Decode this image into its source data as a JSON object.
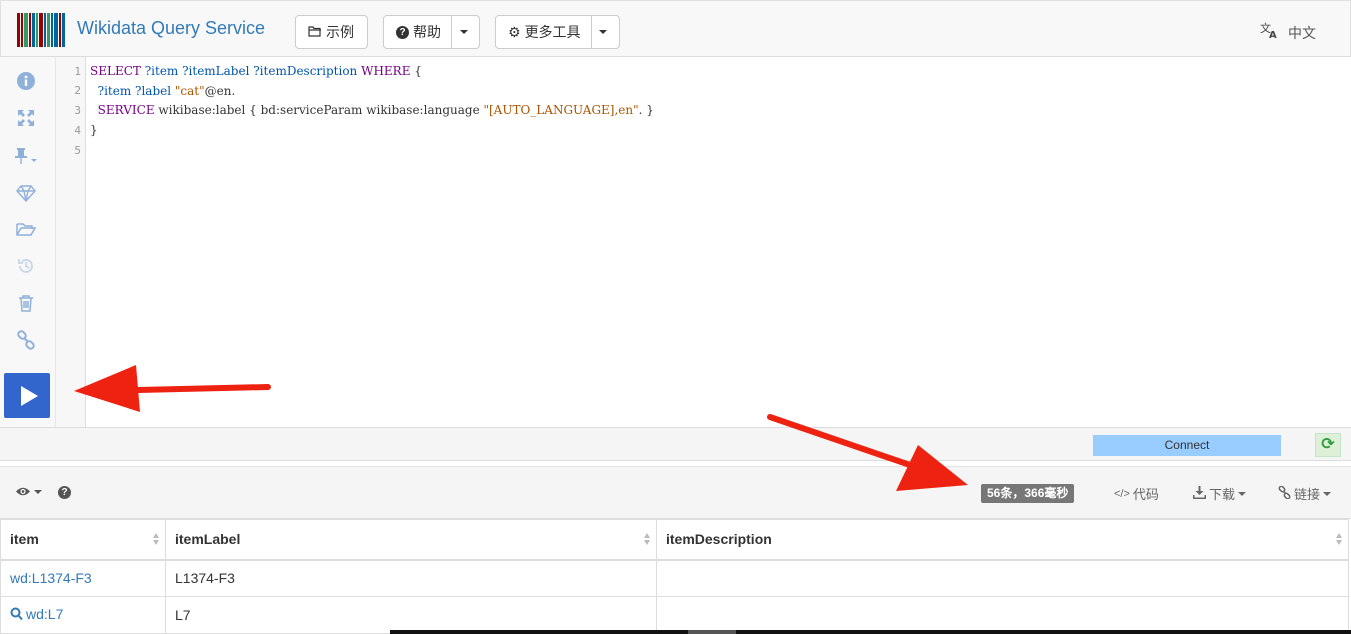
{
  "navbar": {
    "title": "Wikidata Query Service",
    "examples_label": "示例",
    "help_label": "帮助",
    "more_tools_label": "更多工具",
    "language_label": "中文"
  },
  "toolbar": {
    "icons": [
      "info-icon",
      "expand-icon",
      "pin-icon",
      "gem-icon",
      "folder-open-icon",
      "history-icon",
      "trash-icon",
      "link-icon"
    ],
    "run_label": "run"
  },
  "editor": {
    "line_numbers": [
      "1",
      "2",
      "3",
      "4",
      "5"
    ],
    "lines": {
      "l1_kw1": "SELECT",
      "l1_vars": " ?item ?itemLabel ?itemDescription ",
      "l1_kw2": "WHERE",
      "l1_brace": " {",
      "l2_indent": "  ",
      "l2_vars": "?item ?label ",
      "l2_str": "\"cat\"",
      "l2_rest": "@en.",
      "l3_indent": "  ",
      "l3_kw": "SERVICE",
      "l3_mid": " wikibase:label { bd:serviceParam wikibase:language ",
      "l3_str": "\"[AUTO_LANGUAGE],en\"",
      "l3_end": ". }",
      "l4": "}"
    }
  },
  "statusbar": {
    "connect_label": "Connect"
  },
  "results": {
    "count_badge": "56条，366毫秒",
    "code_label": "代码",
    "download_label": "下载",
    "link_label": "链接",
    "columns": [
      "item",
      "itemLabel",
      "itemDescription"
    ],
    "rows": [
      {
        "item": "wd:L1374-F3",
        "itemLabel": "L1374-F3",
        "itemDescription": ""
      },
      {
        "item": "wd:L7",
        "itemLabel": "L7",
        "itemDescription": ""
      }
    ]
  },
  "colors": {
    "accent": "#3366cc",
    "brand": "#337ab7",
    "arrow": "#ee2211"
  }
}
